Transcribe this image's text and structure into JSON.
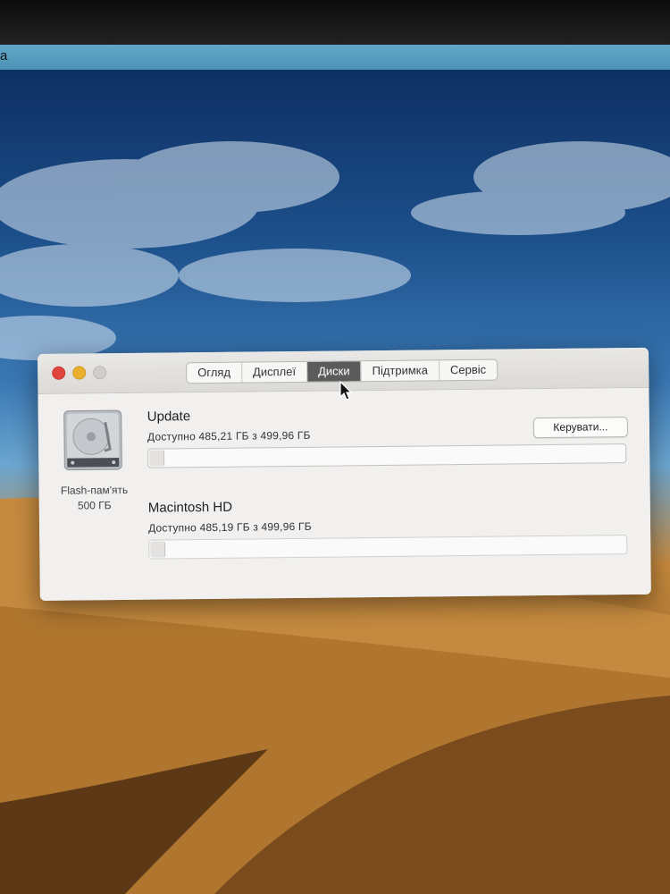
{
  "menubar": {
    "app_fragment": "a"
  },
  "window": {
    "tabs": [
      {
        "label": "Огляд"
      },
      {
        "label": "Дисплеї"
      },
      {
        "label": "Диски",
        "active": true
      },
      {
        "label": "Підтримка"
      },
      {
        "label": "Сервіс"
      }
    ],
    "disk": {
      "name": "Flash-пам'ять",
      "capacity": "500 ГБ"
    },
    "volumes": [
      {
        "name": "Update",
        "available": "Доступно 485,21 ГБ з 499,96 ГБ",
        "used_fraction": 0.03
      },
      {
        "name": "Macintosh HD",
        "available": "Доступно 485,19 ГБ з 499,96 ГБ",
        "used_fraction": 0.03
      }
    ],
    "manage_button": "Керувати..."
  },
  "colors": {
    "close": "#e0443e",
    "minimize": "#e8b02e",
    "active_tab": "#5b5b5b"
  }
}
